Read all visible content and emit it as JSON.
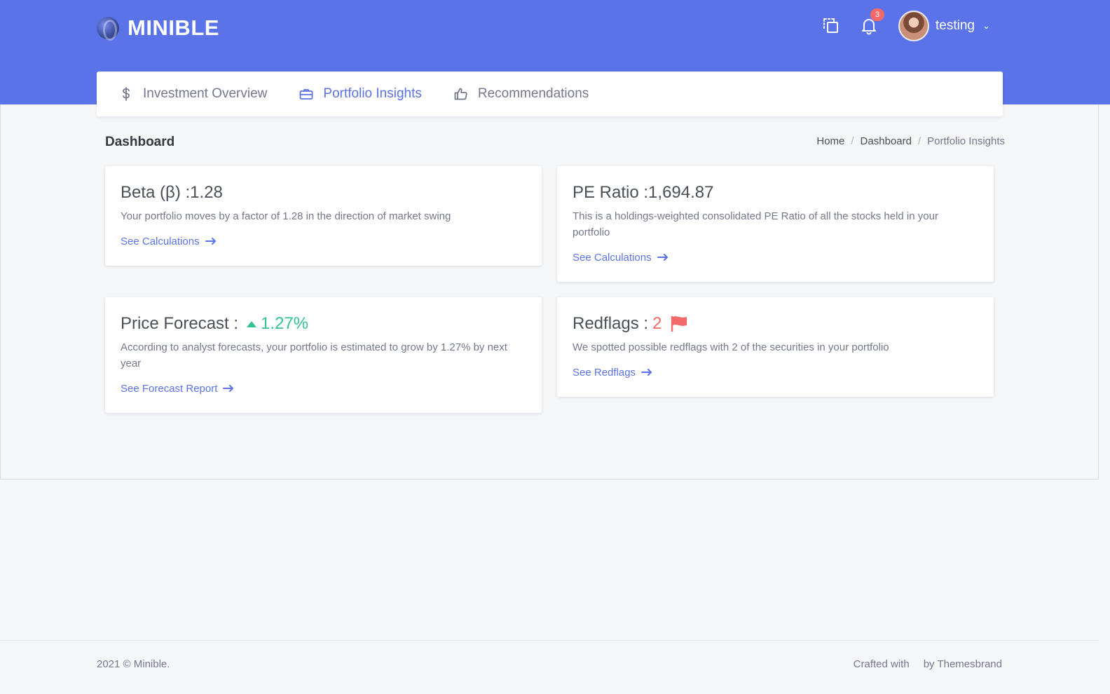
{
  "brand": {
    "name": "MINIBLE"
  },
  "header": {
    "notification_count": "3",
    "user_name": "testing"
  },
  "nav": {
    "items": [
      {
        "label": "Investment Overview",
        "icon": "dollar-icon"
      },
      {
        "label": "Portfolio Insights",
        "icon": "briefcase-icon",
        "active": true
      },
      {
        "label": "Recommendations",
        "icon": "thumbs-up-icon"
      }
    ]
  },
  "page": {
    "title": "Dashboard",
    "breadcrumb": [
      "Home",
      "Dashboard",
      "Portfolio Insights"
    ]
  },
  "cards": {
    "beta": {
      "label": "Beta (β) : ",
      "value": "1.28",
      "desc": "Your portfolio moves by a factor of 1.28 in the direction of market swing",
      "link": "See Calculations"
    },
    "pe": {
      "label": "PE Ratio : ",
      "value": "1,694.87",
      "desc": "This is a holdings-weighted consolidated PE Ratio of all the stocks held in your portfolio",
      "link": "See Calculations"
    },
    "forecast": {
      "label": "Price Forecast : ",
      "value": "1.27%",
      "desc": "According to analyst forecasts, your portfolio is estimated to grow by 1.27% by next year",
      "link": "See Forecast Report"
    },
    "redflags": {
      "label": "Redflags : ",
      "value": "2",
      "desc": "We spotted possible redflags with 2 of the securities in your portfolio",
      "link": "See Redflags"
    }
  },
  "footer": {
    "left": "2021 © Minible.",
    "right_1": "Crafted with",
    "right_2": "by Themesbrand"
  },
  "colors": {
    "primary": "#5b73e8",
    "success": "#34c38f",
    "danger": "#f46a6a",
    "muted": "#74788d"
  }
}
